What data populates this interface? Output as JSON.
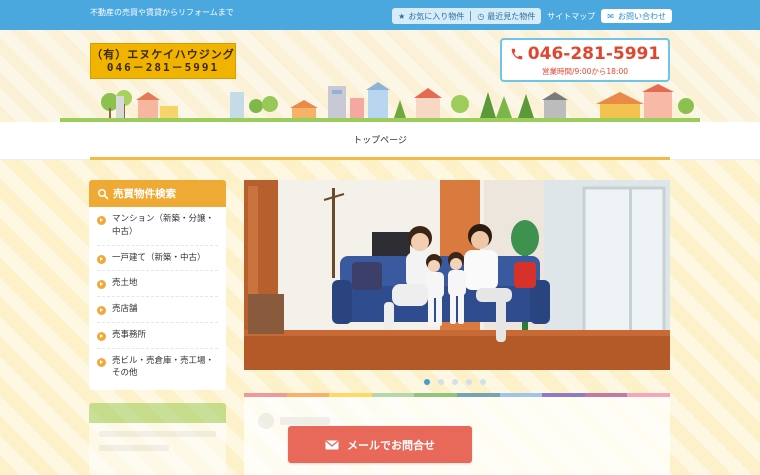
{
  "header": {
    "tagline": "不動産の売買や賃貸からリフォームまで",
    "nav": {
      "favorites": "お気に入り物件",
      "recent": "最近見た物件",
      "sitemap": "サイトマップ",
      "contact": "お問い合わせ"
    },
    "logo": {
      "line1": "（有）エヌケイハウジング",
      "line2": "046－281－5991"
    },
    "phone": {
      "number": "046-281-5991",
      "hours": "営業時間/9:00から18:00"
    }
  },
  "navbar": {
    "home": "トップページ"
  },
  "sidebar": {
    "title": "売買物件検索",
    "items": [
      {
        "label": "マンション（新築・分譲・中古）"
      },
      {
        "label": "一戸建て（新築・中古）"
      },
      {
        "label": "売土地"
      },
      {
        "label": "売店舗"
      },
      {
        "label": "売事務所"
      },
      {
        "label": "売ビル・売倉庫・売工場・その他"
      }
    ]
  },
  "slider": {
    "slide_count": 5,
    "active_index": 0
  },
  "cta": {
    "mail_button": "メールでお問合せ"
  },
  "colors": {
    "accent_blue": "#4aa8df",
    "accent_orange": "#efaa35",
    "phone_red": "#e2452f",
    "cta_red": "#e8685a"
  }
}
